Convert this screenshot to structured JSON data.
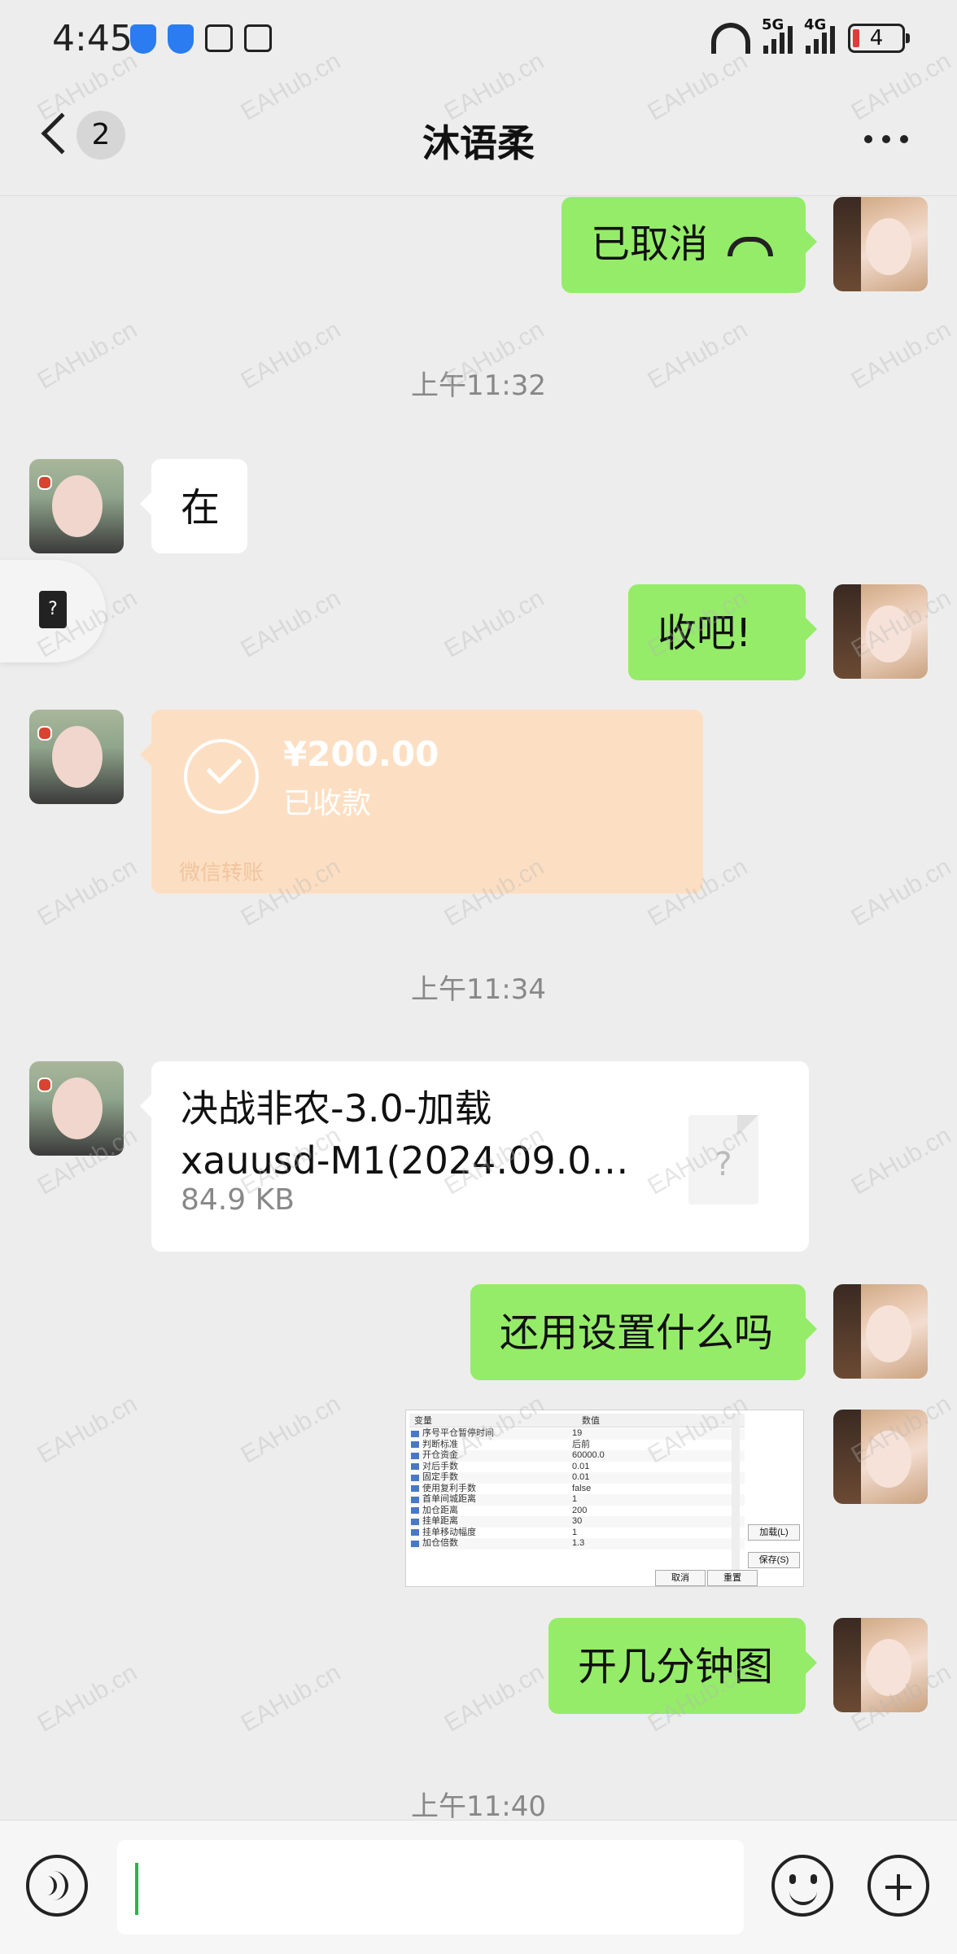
{
  "status": {
    "time": "4:45",
    "net1": "5G",
    "net2": "4G",
    "battery": "4"
  },
  "header": {
    "back_count": "2",
    "title": "沐语柔"
  },
  "messages": {
    "call_cancelled": "已取消",
    "time1": "上午11:32",
    "her_zai": "在",
    "me_shou": "收吧!",
    "transfer_amount": "¥200.00",
    "transfer_status": "已收款",
    "transfer_source": "微信转账",
    "time2": "上午11:34",
    "file_name": "决战非农-3.0-加载xauusd-M1(2024.09.0…",
    "file_size": "84.9 KB",
    "me_settings": "还用设置什么吗",
    "me_timeframe": "开几分钟图",
    "time3": "上午11:40"
  },
  "thumb": {
    "col1": "变量",
    "col2": "数值",
    "rows": [
      {
        "k": "序号平仓暂停时间",
        "v": "19"
      },
      {
        "k": "判断标准",
        "v": "后前"
      },
      {
        "k": "开仓资金",
        "v": "60000.0"
      },
      {
        "k": "对后手数",
        "v": "0.01"
      },
      {
        "k": "固定手数",
        "v": "0.01"
      },
      {
        "k": "使用复利手数",
        "v": "false"
      },
      {
        "k": "首单间城距离",
        "v": "1"
      },
      {
        "k": "加仓距离",
        "v": "200"
      },
      {
        "k": "挂单距离",
        "v": "30"
      },
      {
        "k": "挂单移动幅度",
        "v": "1"
      },
      {
        "k": "加仓倍数",
        "v": "1.3"
      }
    ],
    "btn_load": "加载(L)",
    "btn_save": "保存(S)",
    "btn_reset": "重置",
    "btn_cancel": "取消"
  },
  "watermark": "EAHub.cn",
  "icons": {
    "back": "chevron-left-icon",
    "more": "more-dots-icon",
    "voice": "voice-icon",
    "emoji": "emoji-icon",
    "plus": "plus-icon"
  },
  "colors": {
    "my_bubble": "#95ec69",
    "transfer": "#fcdfc3",
    "cursor": "#2bb24c"
  }
}
